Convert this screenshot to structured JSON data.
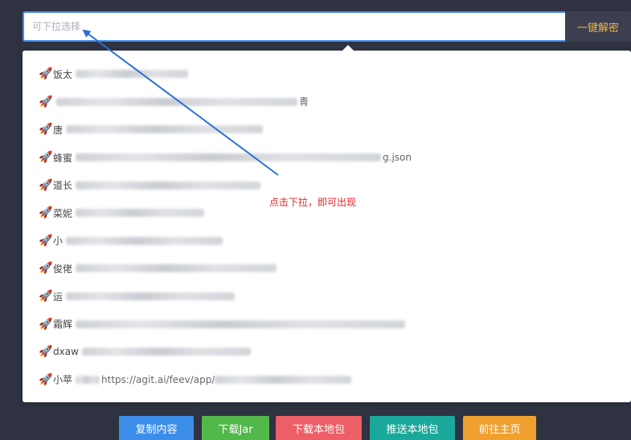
{
  "search": {
    "placeholder": "可下拉选择",
    "button_label": "一键解密"
  },
  "dropdown": {
    "items": [
      {
        "label": "饭太",
        "tail": ""
      },
      {
        "label": "",
        "tail": "青"
      },
      {
        "label": "唐",
        "tail": ""
      },
      {
        "label": "蜂蜜",
        "tail": "g.json"
      },
      {
        "label": "道长",
        "tail": ""
      },
      {
        "label": "菜妮",
        "tail": ""
      },
      {
        "label": "小",
        "tail": ""
      },
      {
        "label": "俊佬",
        "tail": ""
      },
      {
        "label": "运",
        "tail": ""
      },
      {
        "label": "霜辉",
        "tail": ""
      },
      {
        "label": "dxaw",
        "tail": ""
      },
      {
        "label": "小苹",
        "tail": "https://agit.ai/feev/app/"
      }
    ]
  },
  "annotation": "点击下拉，即可出现",
  "actions": [
    {
      "label": "复制内容",
      "color": "#3d8ee8"
    },
    {
      "label": "下载Jar",
      "color": "#53b84a"
    },
    {
      "label": "下载本地包",
      "color": "#ec5f66"
    },
    {
      "label": "推送本地包",
      "color": "#1aa89a"
    },
    {
      "label": "前往主页",
      "color": "#efa02e"
    }
  ],
  "icons": {
    "list_item_icon": "rocket-icon"
  }
}
